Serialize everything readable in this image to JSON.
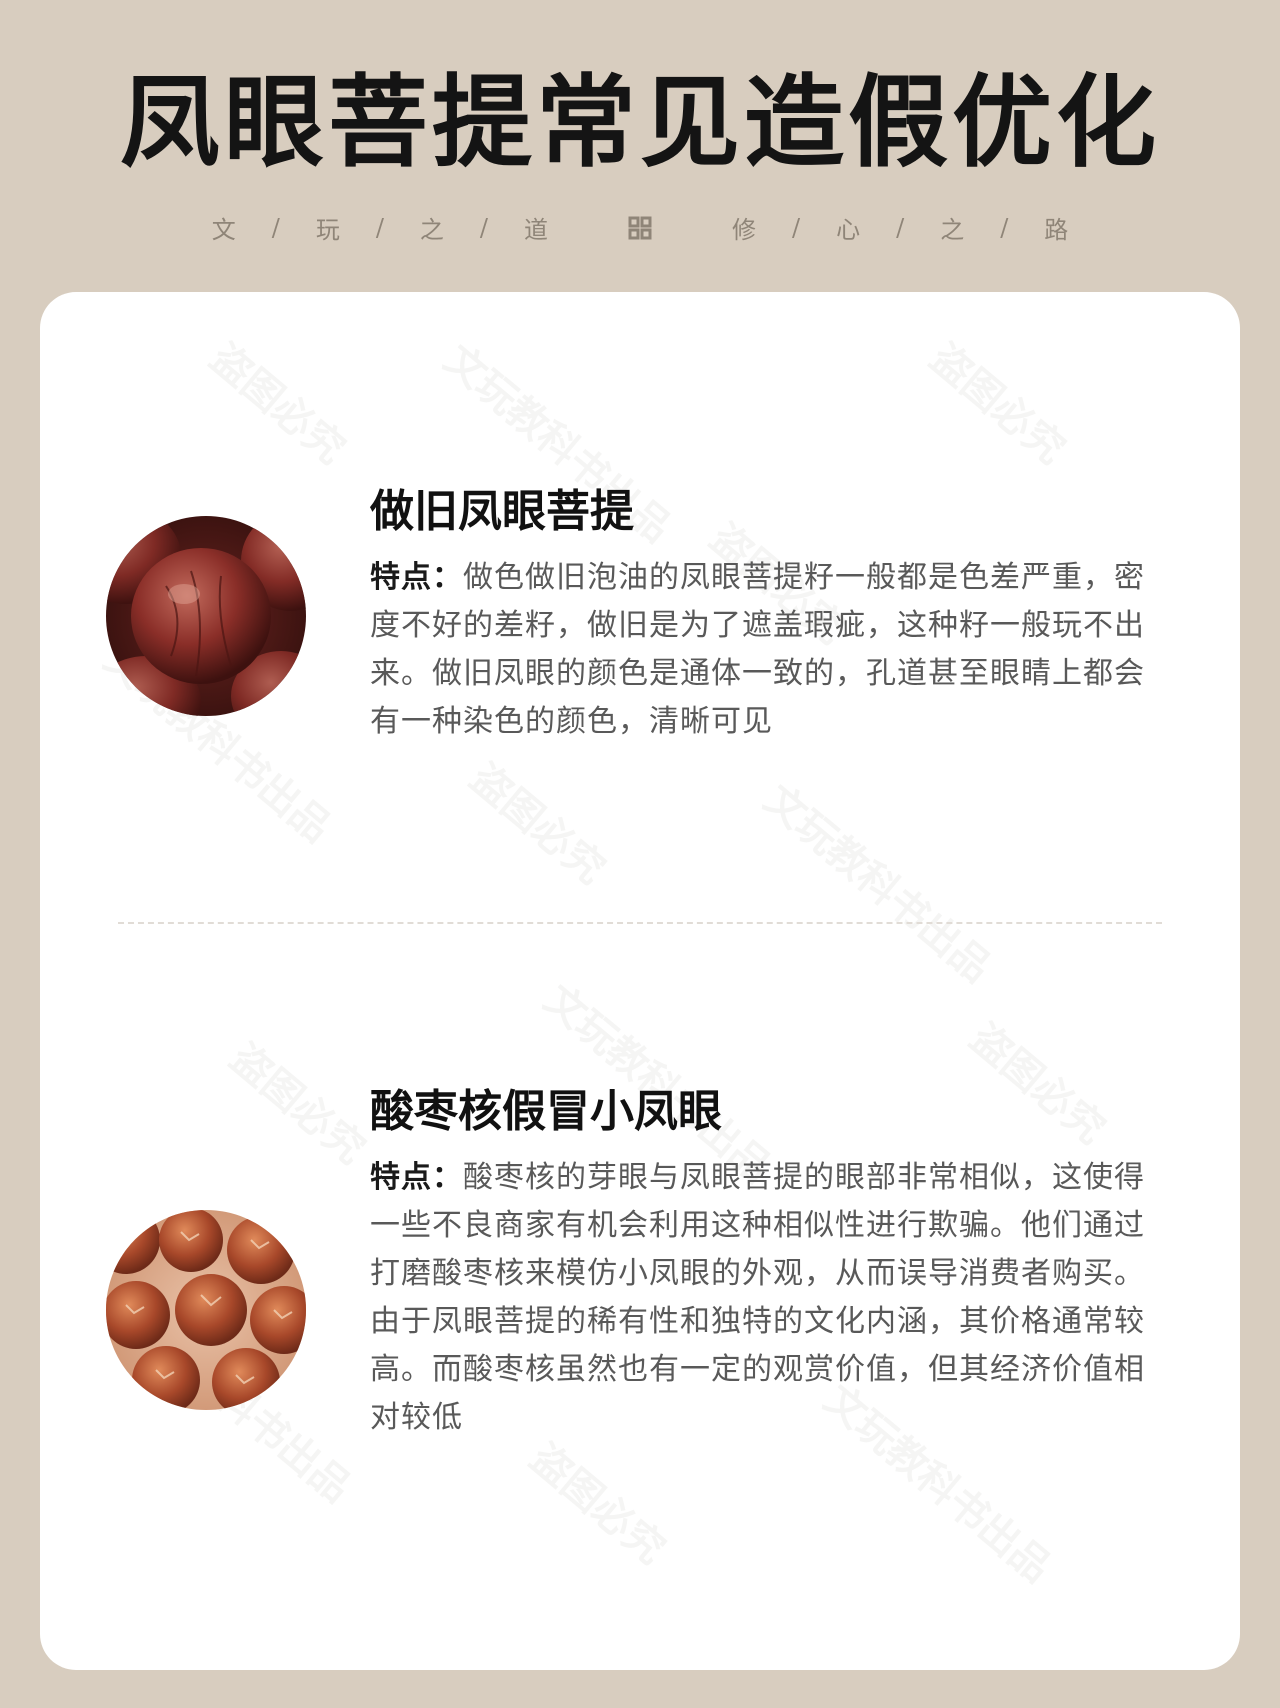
{
  "header": {
    "title": "凤眼菩提常见造假优化",
    "motto_left": [
      "文",
      "玩",
      "之",
      "道"
    ],
    "motto_right": [
      "修",
      "心",
      "之",
      "路"
    ],
    "separator": "/"
  },
  "watermark": {
    "text_a": "文玩教科书出品",
    "text_b": "盗图必究"
  },
  "items": [
    {
      "title": "做旧凤眼菩提",
      "lead": "特点：",
      "description": "做色做旧泡油的凤眼菩提籽一般都是色差严重，密度不好的差籽，做旧是为了遮盖瑕疵，这种籽一般玩不出来。做旧凤眼的颜色是通体一致的，孔道甚至眼睛上都会有一种染色的颜色，清晰可见",
      "image_icon": "dark-red-bodhi-seed-photo"
    },
    {
      "title": "酸枣核假冒小凤眼",
      "lead": "特点：",
      "description": "酸枣核的芽眼与凤眼菩提的眼部非常相似，这使得一些不良商家有机会利用这种相似性进行欺骗。他们通过打磨酸枣核来模仿小凤眼的外观，从而误导消费者购买。由于凤眼菩提的稀有性和独特的文化内涵，其价格通常较高。而酸枣核虽然也有一定的观赏价值，但其经济价值相对较低",
      "image_icon": "jujube-pit-beads-photo"
    }
  ],
  "colors": {
    "background": "#d8cdbf",
    "card": "#ffffff",
    "title": "#141414",
    "body_text": "#595959"
  }
}
